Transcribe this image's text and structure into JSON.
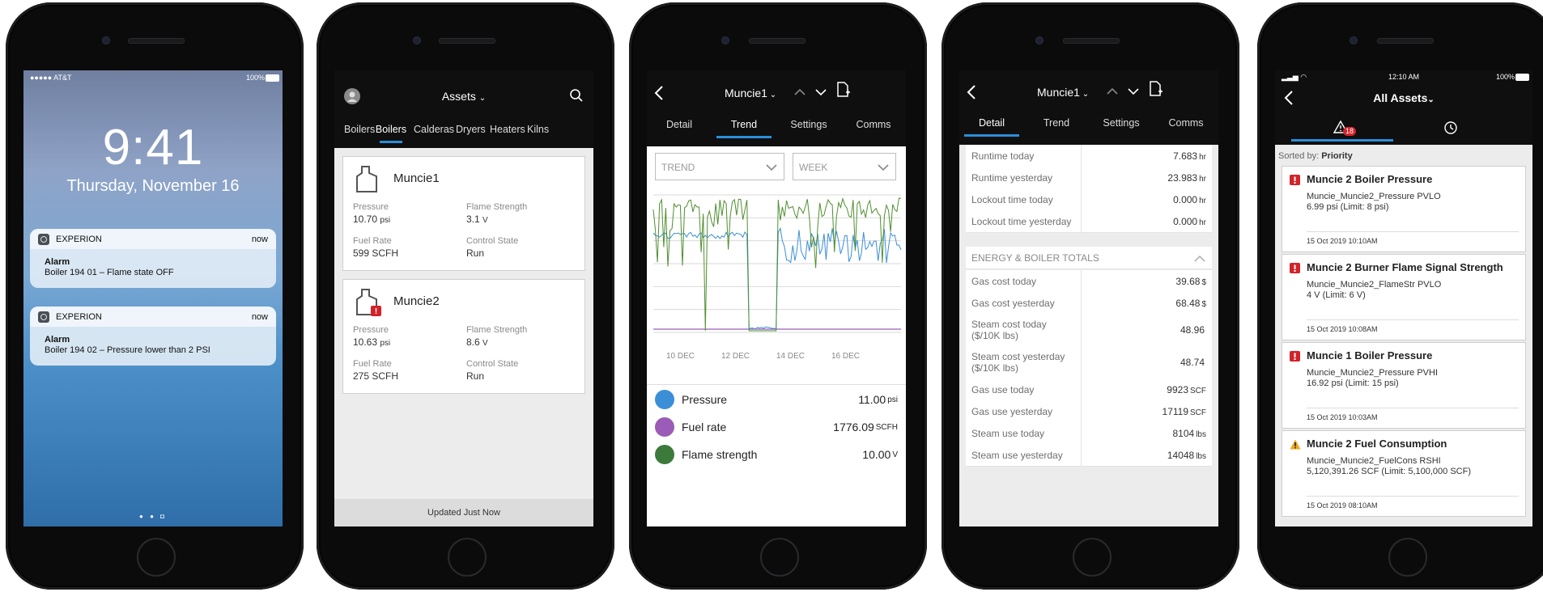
{
  "phone1": {
    "carrier": "●●●●● AT&T",
    "battery": "100%",
    "time": "9:41",
    "date": "Thursday, November 16",
    "notifications": [
      {
        "app": "EXPERION",
        "when": "now",
        "title": "Alarm",
        "body": "Boiler 194 01 – Flame state OFF"
      },
      {
        "app": "EXPERION",
        "when": "now",
        "title": "Alarm",
        "body": "Boiler 194 02 – Pressure lower than 2 PSI"
      }
    ]
  },
  "phone2": {
    "header_title": "Assets",
    "tabs": [
      "Boilers",
      "Boilers",
      "Calderas",
      "Dryers",
      "Heaters",
      "Kilns"
    ],
    "cards": [
      {
        "name": "Muncie1",
        "pressure_label": "Pressure",
        "pressure": "10.70",
        "pressure_unit": "psi",
        "flame_label": "Flame Strength",
        "flame": "3.1",
        "flame_unit": "V",
        "fuel_label": "Fuel Rate",
        "fuel": "599 SCFH",
        "state_label": "Control State",
        "state": "Run"
      },
      {
        "name": "Muncie2",
        "pressure_label": "Pressure",
        "pressure": "10.63",
        "pressure_unit": "psi",
        "flame_label": "Flame Strength",
        "flame": "8.6",
        "flame_unit": "V",
        "fuel_label": "Fuel Rate",
        "fuel": "275 SCFH",
        "state_label": "Control State",
        "state": "Run"
      }
    ],
    "footer": "Updated Just Now"
  },
  "phone3": {
    "title": "Muncie1",
    "tabs": [
      "Detail",
      "Trend",
      "Settings",
      "Comms"
    ],
    "trend_select": "TREND",
    "period_select": "WEEK",
    "x_ticks": [
      "10 DEC",
      "12 DEC",
      "14 DEC",
      "16 DEC"
    ],
    "legend": [
      {
        "name": "Pressure",
        "value": "11.00",
        "unit": "psi",
        "color": "#3b8fd6"
      },
      {
        "name": "Fuel rate",
        "value": "1776.09",
        "unit": "SCFH",
        "color": "#9a5cb6"
      },
      {
        "name": "Flame strength",
        "value": "10.00",
        "unit": "V",
        "color": "#3b7a3b"
      }
    ],
    "colors": {
      "pressure": "#3b8fd6",
      "fuel": "#9a5cb6",
      "flame": "#4f8f2f"
    }
  },
  "phone4": {
    "title": "Muncie1",
    "tabs": [
      "Detail",
      "Trend",
      "Settings",
      "Comms"
    ],
    "rows_top": [
      {
        "label": "Runtime today",
        "value": "7.683",
        "unit": "hr"
      },
      {
        "label": "Runtime yesterday",
        "value": "23.983",
        "unit": "hr"
      },
      {
        "label": "Lockout time today",
        "value": "0.000",
        "unit": "hr"
      },
      {
        "label": "Lockout time yesterday",
        "value": "0.000",
        "unit": "hr"
      }
    ],
    "section": "ENERGY & BOILER TOTALS",
    "rows_bottom": [
      {
        "label": "Gas cost today",
        "value": "39.68",
        "unit": "$"
      },
      {
        "label": "Gas cost yesterday",
        "value": "68.48",
        "unit": "$"
      },
      {
        "label": "Steam cost today ($/10K lbs)",
        "value": "48.96",
        "unit": ""
      },
      {
        "label": "Steam cost yesterday ($/10K lbs)",
        "value": "48.74",
        "unit": ""
      },
      {
        "label": "Gas use today",
        "value": "9923",
        "unit": "SCF"
      },
      {
        "label": "Gas use yesterday",
        "value": "17119",
        "unit": "SCF"
      },
      {
        "label": "Steam use today",
        "value": "8104",
        "unit": "lbs"
      },
      {
        "label": "Steam use yesterday",
        "value": "14048",
        "unit": "lbs"
      }
    ]
  },
  "phone5": {
    "time": "12:10 AM",
    "battery": "100%",
    "title": "All Assets",
    "alarm_count": "18",
    "sorted_label": "Sorted by:",
    "sorted_value": "Priority",
    "alarms": [
      {
        "severity": "high",
        "title": "Muncie 2 Boiler Pressure",
        "tag": "Muncie_Muncie2_Pressure PVLO",
        "detail": "6.99 psi  (Limit: 8 psi)",
        "time": "15 Oct 2019  10:10AM"
      },
      {
        "severity": "high",
        "title": "Muncie 2 Burner Flame Signal Strength",
        "tag": "Muncie_Muncie2_FlameStr PVLO",
        "detail": "4 V (Limit: 6 V)",
        "time": "15 Oct 2019  10:08AM"
      },
      {
        "severity": "high",
        "title": "Muncie 1 Boiler Pressure",
        "tag": "Muncie_Muncie2_Pressure PVHI",
        "detail": "16.92 psi  (Limit: 15 psi)",
        "time": "15 Oct 2019  10:03AM"
      },
      {
        "severity": "medium",
        "title": "Muncie 2 Fuel Consumption",
        "tag": "Muncie_Muncie2_FuelCons RSHI",
        "detail": "5,120,391.26 SCF (Limit: 5,100,000 SCF)",
        "time": "15 Oct 2019  08:10AM"
      }
    ]
  }
}
